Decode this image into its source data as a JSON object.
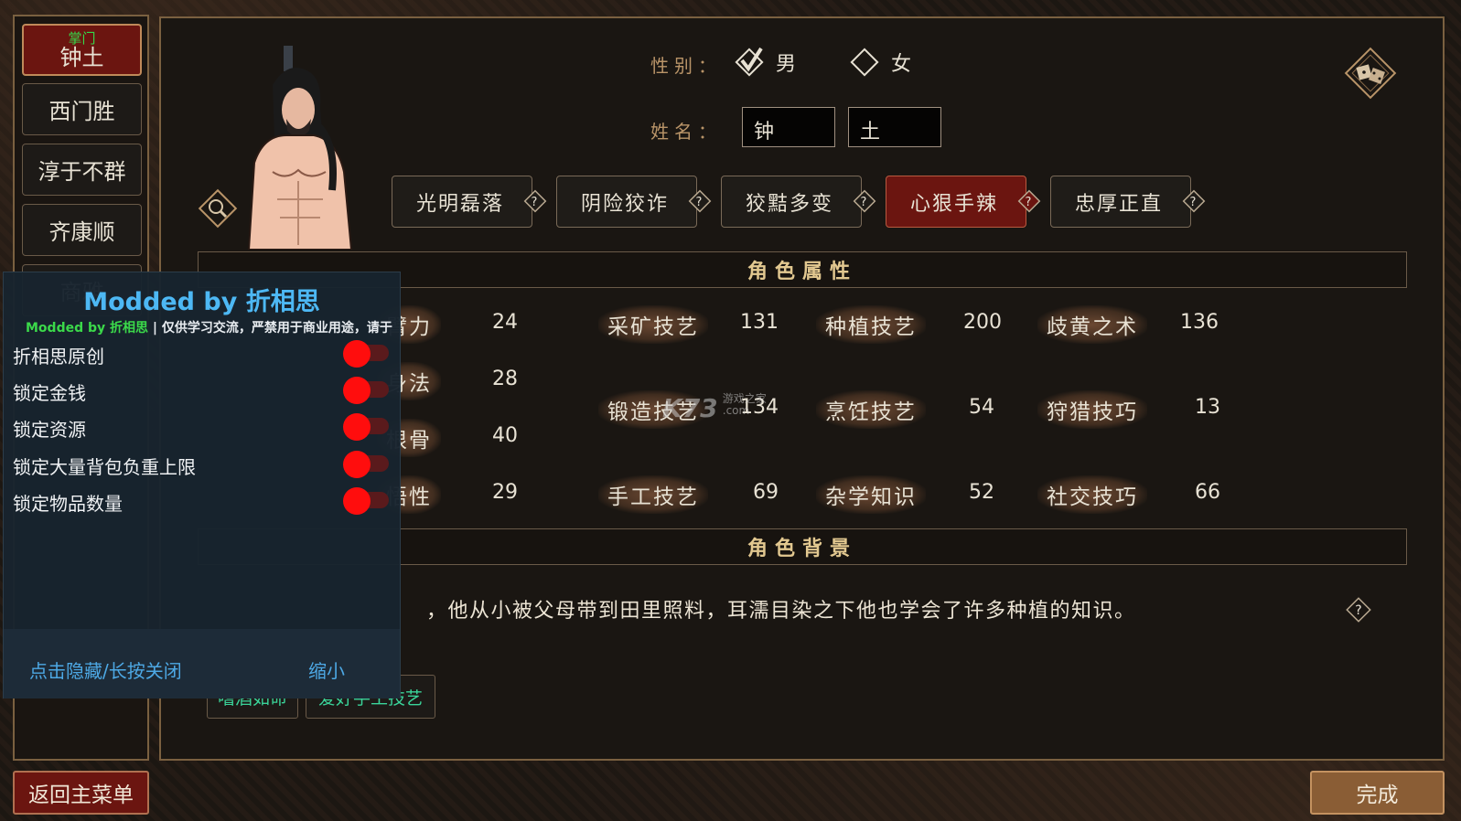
{
  "sidebar": {
    "items": [
      {
        "tag": "掌门",
        "name": "钟土",
        "selected": true
      },
      {
        "name": "西门胜"
      },
      {
        "name": "淳于不群"
      },
      {
        "name": "齐康顺"
      },
      {
        "name": "商雅"
      }
    ]
  },
  "character": {
    "gender_label": "性别：",
    "gender_options": [
      "男",
      "女"
    ],
    "gender_selected": "男",
    "name_label": "姓名：",
    "surname": "钟",
    "given_name": "土"
  },
  "traits": [
    {
      "label": "光明磊落",
      "active": false
    },
    {
      "label": "阴险狡诈",
      "active": false
    },
    {
      "label": "狡黠多变",
      "active": false
    },
    {
      "label": "心狠手辣",
      "active": true
    },
    {
      "label": "忠厚正直",
      "active": false
    }
  ],
  "attributes": {
    "title": "角色属性",
    "base": [
      {
        "name": "臂力",
        "value": "24"
      },
      {
        "name": "身法",
        "value": "28"
      },
      {
        "name": "根骨",
        "value": "40"
      },
      {
        "name": "悟性",
        "value": "29"
      }
    ],
    "skills": [
      {
        "name": "采矿技艺",
        "value": "131"
      },
      {
        "name": "种植技艺",
        "value": "200"
      },
      {
        "name": "歧黄之术",
        "value": "136"
      },
      {
        "name": "锻造技艺",
        "value": "134"
      },
      {
        "name": "烹饪技艺",
        "value": "54"
      },
      {
        "name": "狩猎技巧",
        "value": "13"
      },
      {
        "name": "手工技艺",
        "value": "69"
      },
      {
        "name": "杂学知识",
        "value": "52"
      },
      {
        "name": "社交技巧",
        "value": "66"
      }
    ]
  },
  "background": {
    "title": "角色背景",
    "text": "，他从小被父母带到田里照料，耳濡目染之下他也学会了许多种植的知识。",
    "hobbies": [
      "嗜酒如命",
      "爱好手工技艺"
    ]
  },
  "buttons": {
    "back": "返回主菜单",
    "done": "完成"
  },
  "mod_menu": {
    "title": "Modded by 折相思",
    "subtitle_prefix": "Modded by ",
    "subtitle_author": "折相思",
    "subtitle_rest": " | 仅供学习交流，严禁用于商业用途，请于",
    "items": [
      {
        "label": "折相思原创",
        "enabled": true
      },
      {
        "label": "锁定金钱",
        "enabled": true
      },
      {
        "label": "锁定资源",
        "enabled": true
      },
      {
        "label": "锁定大量背包负重上限",
        "enabled": true
      },
      {
        "label": "锁定物品数量",
        "enabled": true
      }
    ],
    "hide_link": "点击隐藏/长按关闭",
    "minimize_link": "缩小"
  },
  "watermark": {
    "brand": "K73",
    "sub": "游戏之家",
    "domain": ".com"
  },
  "colors": {
    "selected_red": "#6b1510",
    "gold_label": "#b99468",
    "mod_blue": "#4db8f4",
    "toggle_red": "#ff0d0d",
    "hobby_green": "#3ad49a"
  }
}
